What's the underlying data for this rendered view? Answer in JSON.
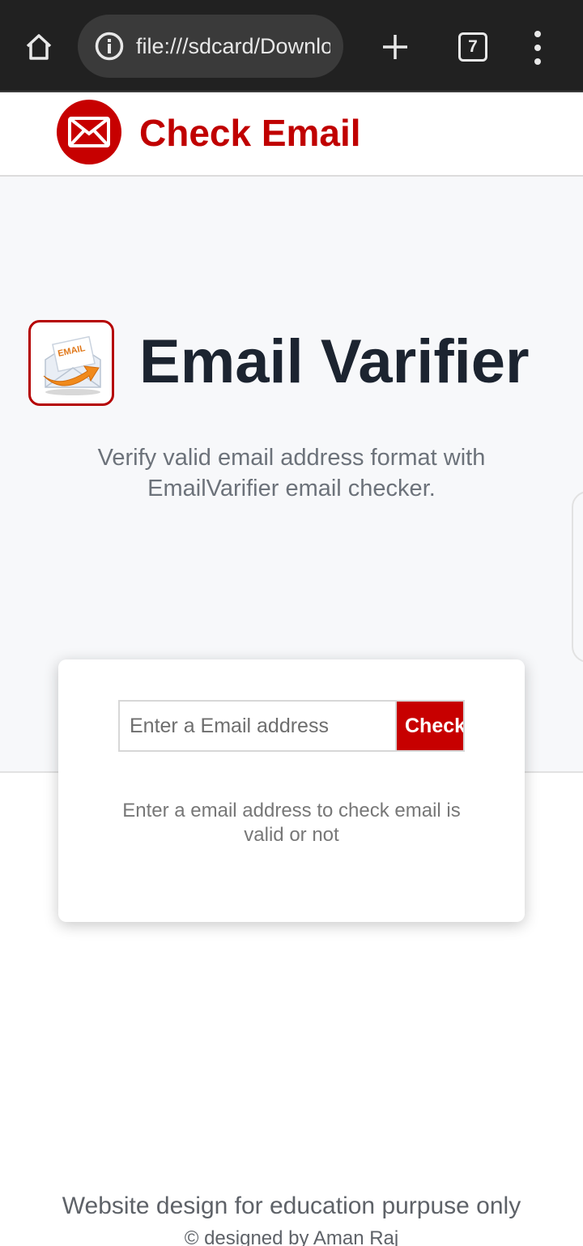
{
  "browser": {
    "url": "file:///sdcard/Download",
    "tab_count": "7",
    "icons": [
      "home-icon",
      "info-icon",
      "plus-icon",
      "tabs-icon",
      "more-vert-icon"
    ]
  },
  "header": {
    "brand": "Check Email",
    "logo_icon": "envelope-icon"
  },
  "hero": {
    "title": "Email Varifier",
    "subtitle": "Verify valid email address format with EmailVarifier email checker.",
    "app_icon": "email-send-icon",
    "app_icon_label": "EMAIL"
  },
  "checker": {
    "input_placeholder": "Enter a Email address",
    "input_value": "",
    "button_label": "Check",
    "message": "Enter a email address to check email is valid or not"
  },
  "footer": {
    "line1": "Website design for education purpuse only",
    "line2": "© designed by Aman Raj"
  },
  "colors": {
    "brand_red": "#c70000",
    "title_dark": "#1c2430",
    "hero_bg": "#f7f8fa",
    "browser_bar": "#212121"
  }
}
